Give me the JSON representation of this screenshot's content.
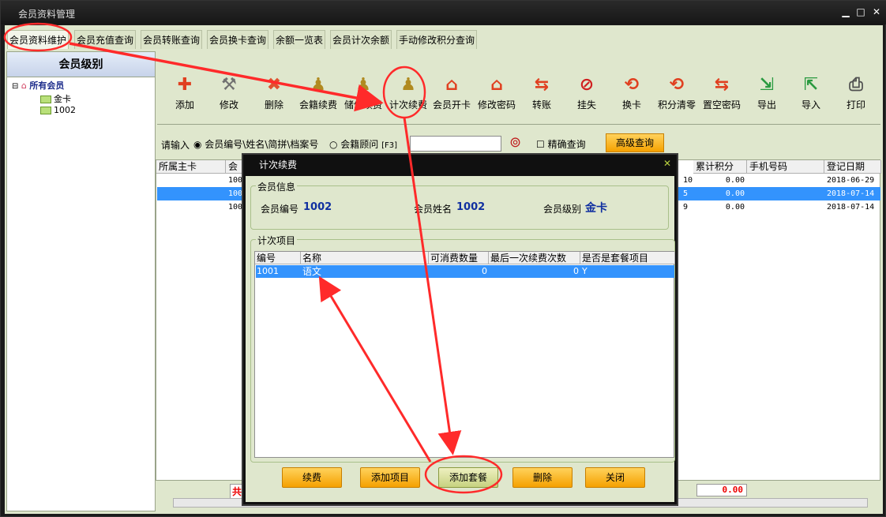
{
  "window": {
    "title": "会员资料管理"
  },
  "tabs": [
    "会员资料维护",
    "会员充值查询",
    "会员转账查询",
    "会员换卡查询",
    "余额一览表",
    "会员计次余额",
    "手动修改积分查询"
  ],
  "level_panel": {
    "title": "会员级别",
    "root": "所有会员",
    "children": [
      "金卡",
      "1002"
    ]
  },
  "toolbar": [
    {
      "label": "添加",
      "icon": "plus-icon",
      "color": "#e04020"
    },
    {
      "label": "修改",
      "icon": "wrench-icon",
      "color": "#707070"
    },
    {
      "label": "删除",
      "icon": "delete-x-icon",
      "color": "#e05030"
    },
    {
      "label": "会籍续费",
      "icon": "pawn-icon",
      "color": "#b08a20"
    },
    {
      "label": "储值续费",
      "icon": "pawn-icon",
      "color": "#b08a20"
    },
    {
      "label": "计次续费",
      "icon": "pawn-icon",
      "color": "#b08a20"
    },
    {
      "label": "会员开卡",
      "icon": "house-icon",
      "color": "#e04020"
    },
    {
      "label": "修改密码",
      "icon": "house-icon",
      "color": "#e04020"
    },
    {
      "label": "转账",
      "icon": "transfer-icon",
      "color": "#e04020"
    },
    {
      "label": "挂失",
      "icon": "forbidden-icon",
      "color": "#d02020"
    },
    {
      "label": "换卡",
      "icon": "swap-icon",
      "color": "#e04020"
    },
    {
      "label": "积分清零",
      "icon": "swap-icon",
      "color": "#e04020"
    },
    {
      "label": "置空密码",
      "icon": "transfer-icon",
      "color": "#e04020"
    },
    {
      "label": "导出",
      "icon": "export-icon",
      "color": "#2a9a40"
    },
    {
      "label": "导入",
      "icon": "import-icon",
      "color": "#2a9a40"
    },
    {
      "label": "打印",
      "icon": "printer-icon",
      "color": "#505050"
    }
  ],
  "search": {
    "prompt": "请输入",
    "option1": "会员编号\\姓名\\简拼\\档案号",
    "option2": "会籍顾问",
    "hotkey": "[F3]",
    "value": "",
    "exact": "精确查询",
    "advanced": "高级查询"
  },
  "grid": {
    "headers_left": [
      "所属主卡",
      "会"
    ],
    "headers_right": [
      "累计积分",
      "手机号码",
      "登记日期"
    ],
    "rows": [
      {
        "code": "1001",
        "cnt": "10",
        "points": "0.00",
        "phone": "",
        "date": "2018-06-29"
      },
      {
        "code": "1002",
        "cnt": "5",
        "points": "0.00",
        "phone": "",
        "date": "2018-07-14"
      },
      {
        "code": "1003",
        "cnt": "9",
        "points": "0.00",
        "phone": "",
        "date": "2018-07-14"
      }
    ],
    "total_prefix": "共3",
    "total_value": "0.00"
  },
  "dialog": {
    "title": "计次续费",
    "info_group": "会员信息",
    "member_no_label": "会员编号",
    "member_no": "1002",
    "member_name_label": "会员姓名",
    "member_name": "1002",
    "member_level_label": "会员级别",
    "member_level": "金卡",
    "items_group": "计次项目",
    "columns": [
      "编号",
      "名称",
      "可消费数量",
      "最后一次续费次数",
      "是否是套餐项目"
    ],
    "items": [
      {
        "code": "1001",
        "name": "语文",
        "qty": "0",
        "last": "0",
        "combo": "Y"
      }
    ],
    "buttons": [
      "续费",
      "添加项目",
      "添加套餐",
      "删除",
      "关闭"
    ]
  },
  "colors": {
    "accent": "#3393fd",
    "highlight": "#ff2a2a"
  }
}
